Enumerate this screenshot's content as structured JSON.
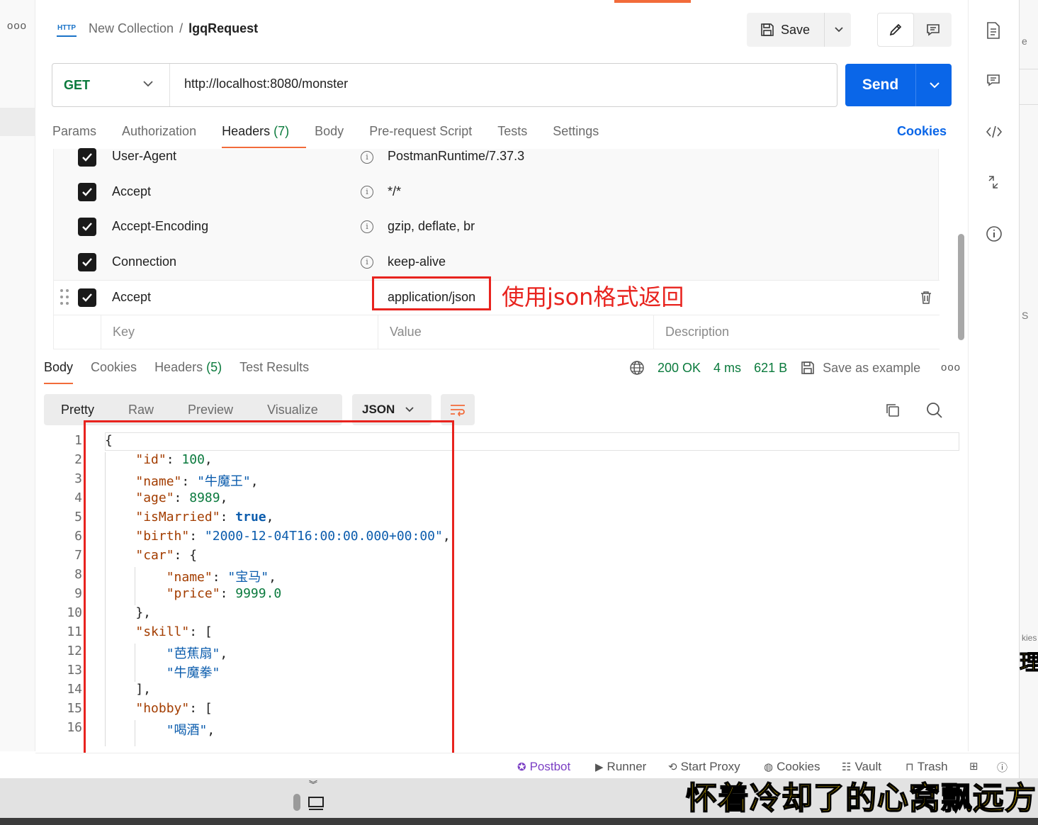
{
  "breadcrumb": {
    "http_badge": "HTTP",
    "collection": "New Collection",
    "separator": "/",
    "request": "lgqRequest"
  },
  "toolbar": {
    "save_label": "Save"
  },
  "request": {
    "method": "GET",
    "url": "http://localhost:8080/monster",
    "send_label": "Send"
  },
  "request_tabs": {
    "params": "Params",
    "authorization": "Authorization",
    "headers": "Headers",
    "headers_count": "(7)",
    "body": "Body",
    "pre_request": "Pre-request Script",
    "tests": "Tests",
    "settings": "Settings",
    "cookies": "Cookies"
  },
  "headers": {
    "rows": [
      {
        "key": "User-Agent",
        "value": "PostmanRuntime/7.37.3"
      },
      {
        "key": "Accept",
        "value": "*/*"
      },
      {
        "key": "Accept-Encoding",
        "value": "gzip, deflate, br"
      },
      {
        "key": "Connection",
        "value": "keep-alive"
      },
      {
        "key": "Accept",
        "value": "application/json"
      }
    ],
    "placeholder_key": "Key",
    "placeholder_value": "Value",
    "placeholder_desc": "Description"
  },
  "annotation": "使用json格式返回",
  "response_tabs": {
    "body": "Body",
    "cookies": "Cookies",
    "headers": "Headers",
    "headers_count": "(5)",
    "test_results": "Test Results"
  },
  "response_status": {
    "status": "200 OK",
    "time": "4 ms",
    "size": "621 B",
    "save_example": "Save as example"
  },
  "view_tabs": {
    "pretty": "Pretty",
    "raw": "Raw",
    "preview": "Preview",
    "visualize": "Visualize",
    "format": "JSON"
  },
  "code_lines": [
    "1",
    "2",
    "3",
    "4",
    "5",
    "6",
    "7",
    "8",
    "9",
    "10",
    "11",
    "12",
    "13",
    "14",
    "15",
    "16"
  ],
  "body_json": {
    "open": "{",
    "id_key": "\"id\"",
    "id_val": "100",
    "name_key": "\"name\"",
    "name_val": "\"牛魔王\"",
    "age_key": "\"age\"",
    "age_val": "8989",
    "married_key": "\"isMarried\"",
    "married_val": "true",
    "birth_key": "\"birth\"",
    "birth_val": "\"2000-12-04T16:00:00.000+00:00\"",
    "car_key": "\"car\"",
    "car_name_key": "\"name\"",
    "car_name_val": "\"宝马\"",
    "car_price_key": "\"price\"",
    "car_price_val": "9999.0",
    "skill_key": "\"skill\"",
    "skill_1": "\"芭蕉扇\"",
    "skill_2": "\"牛魔拳\"",
    "hobby_key": "\"hobby\"",
    "hobby_1": "\"喝酒\""
  },
  "statusbar": {
    "postbot": "Postbot",
    "runner": "Runner",
    "start_proxy": "Start Proxy",
    "cookies": "Cookies",
    "vault": "Vault",
    "trash": "Trash"
  },
  "edge": {
    "text_1": "e",
    "text_2": "S",
    "text_3": "kies",
    "text_4": "理"
  },
  "subtitle": "怀着冷却了的心窝飘远方",
  "colors": {
    "accent": "#f26b3a",
    "send": "#0a66e8",
    "annotation": "#e8231e",
    "status_ok": "#0a7a3c"
  }
}
